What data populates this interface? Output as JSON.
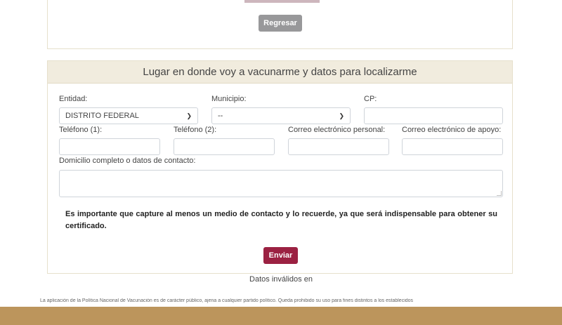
{
  "top": {
    "back_label": "Regresar"
  },
  "form": {
    "title": "Lugar en donde voy a vacunarme y datos para localizarme",
    "entidad": {
      "label": "Entidad:",
      "value": "DISTRITO FEDERAL"
    },
    "municipio": {
      "label": "Municipio:",
      "value": "--"
    },
    "cp": {
      "label": "CP:",
      "value": ""
    },
    "telefono1": {
      "label": "Teléfono (1):",
      "value": ""
    },
    "telefono2": {
      "label": "Teléfono (2):",
      "value": ""
    },
    "correo_personal": {
      "label": "Correo electrónico personal:",
      "value": ""
    },
    "correo_apoyo": {
      "label": "Correo electrónico de apoyo:",
      "value": ""
    },
    "domicilio": {
      "label": "Domicilio completo o datos de contacto:",
      "value": ""
    },
    "notice": "Es importante que capture al menos un medio de contacto y lo recuerde, ya que será indispensable para obtener su certificado.",
    "send_label": "Enviar"
  },
  "status": {
    "invalid_text": "Datos inválidos en"
  },
  "footer": {
    "legal_text": "La aplicación de la Política Nacional de Vacunación es de carácter público, ajena a cualquier partido político. Queda prohibido su uso para fines distintos a los establecidos"
  },
  "colors": {
    "header_bg": "#f1ecde",
    "send_button": "#9b2142",
    "back_button": "#98989a",
    "footer_band": "#bc955c"
  }
}
